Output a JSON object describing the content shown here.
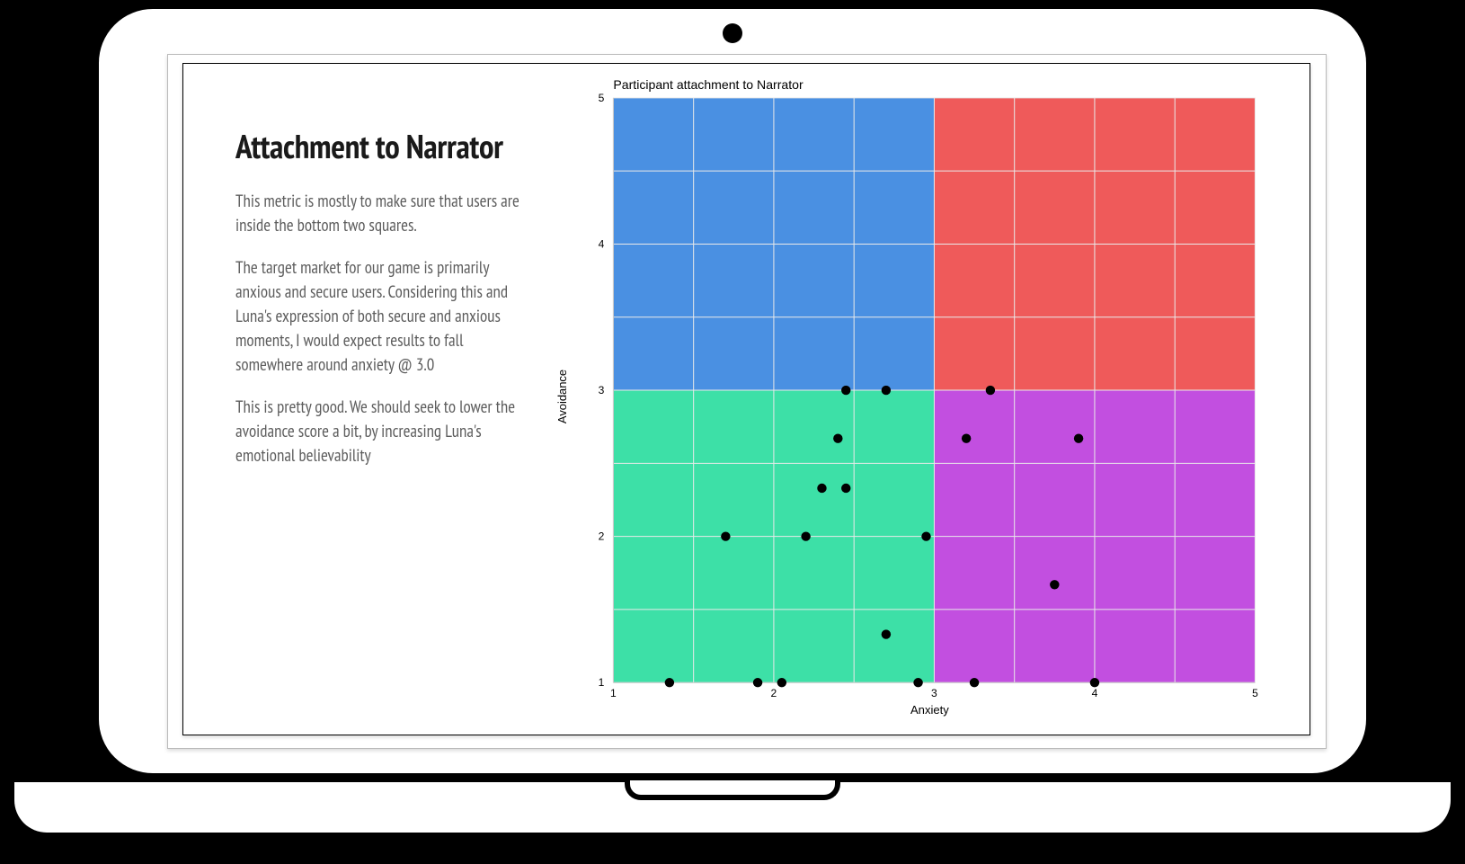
{
  "slide": {
    "title": "Attachment to Narrator",
    "para1": "This metric is mostly to make sure that users are inside the bottom two squares.",
    "para2": "The target market for our game is primarily anxious and secure users. Considering this and Luna's expression of both secure and anxious moments, I would expect results to fall somewhere around anxiety @ 3.0",
    "para3": "This is pretty good. We should seek to lower the avoidance score a bit, by increasing Luna's emotional believability"
  },
  "chart_data": {
    "type": "scatter",
    "title": "Participant attachment to Narrator",
    "xlabel": "Anxiety",
    "ylabel": "Avoidance",
    "xlim": [
      1,
      5
    ],
    "ylim": [
      1,
      5
    ],
    "xticks": [
      1,
      2,
      3,
      4,
      5
    ],
    "yticks": [
      1,
      2,
      3,
      4,
      5
    ],
    "quadrants": {
      "top_left": {
        "x": [
          1,
          3
        ],
        "y": [
          3,
          5
        ],
        "color": "#4a90e2"
      },
      "top_right": {
        "x": [
          3,
          5
        ],
        "y": [
          3,
          5
        ],
        "color": "#ef5a5a"
      },
      "bot_left": {
        "x": [
          1,
          3
        ],
        "y": [
          1,
          3
        ],
        "color": "#3de0a7"
      },
      "bot_right": {
        "x": [
          3,
          5
        ],
        "y": [
          1,
          3
        ],
        "color": "#c24fe0"
      }
    },
    "points": [
      {
        "x": 1.35,
        "y": 1.0
      },
      {
        "x": 1.9,
        "y": 1.0
      },
      {
        "x": 2.05,
        "y": 1.0
      },
      {
        "x": 2.9,
        "y": 1.0
      },
      {
        "x": 3.25,
        "y": 1.0
      },
      {
        "x": 4.0,
        "y": 1.0
      },
      {
        "x": 2.7,
        "y": 1.33
      },
      {
        "x": 3.75,
        "y": 1.67
      },
      {
        "x": 1.7,
        "y": 2.0
      },
      {
        "x": 2.2,
        "y": 2.0
      },
      {
        "x": 2.95,
        "y": 2.0
      },
      {
        "x": 2.3,
        "y": 2.33
      },
      {
        "x": 2.45,
        "y": 2.33
      },
      {
        "x": 2.4,
        "y": 2.67
      },
      {
        "x": 3.2,
        "y": 2.67
      },
      {
        "x": 3.9,
        "y": 2.67
      },
      {
        "x": 2.45,
        "y": 3.0
      },
      {
        "x": 2.7,
        "y": 3.0
      },
      {
        "x": 3.35,
        "y": 3.0
      }
    ]
  }
}
